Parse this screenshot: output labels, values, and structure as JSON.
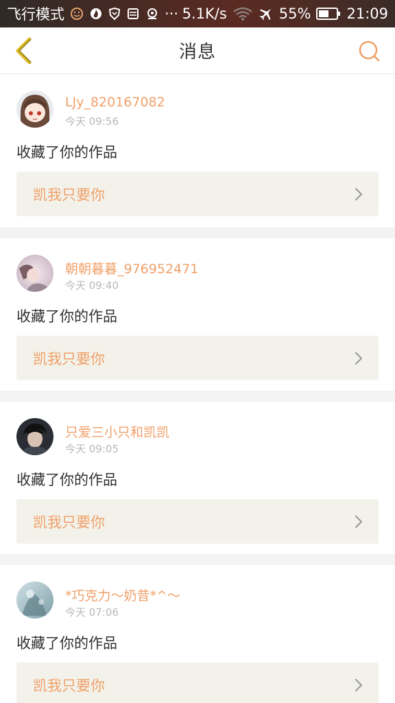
{
  "status_bar": {
    "airplane_mode": "飞行模式",
    "dots": "···",
    "speed": "5.1K/s",
    "battery": "55%",
    "time": "21:09"
  },
  "header": {
    "title": "消息"
  },
  "colors": {
    "accent": "#f0a06a",
    "card_link_bg": "#f3f2ea",
    "page_bg": "#f3f3f3"
  },
  "messages": [
    {
      "username": "LJy_820167082",
      "time": "今天 09:56",
      "action": "收藏了你的作品",
      "work_title": "凯我只要你"
    },
    {
      "username": "朝朝暮暮_976952471",
      "time": "今天 09:40",
      "action": "收藏了你的作品",
      "work_title": "凯我只要你"
    },
    {
      "username": "只爱三小只和凯凯",
      "time": "今天 09:05",
      "action": "收藏了你的作品",
      "work_title": "凯我只要你"
    },
    {
      "username": "*巧克力～奶昔*^～",
      "time": "今天 07:06",
      "action": "收藏了你的作品",
      "work_title": "凯我只要你"
    }
  ]
}
